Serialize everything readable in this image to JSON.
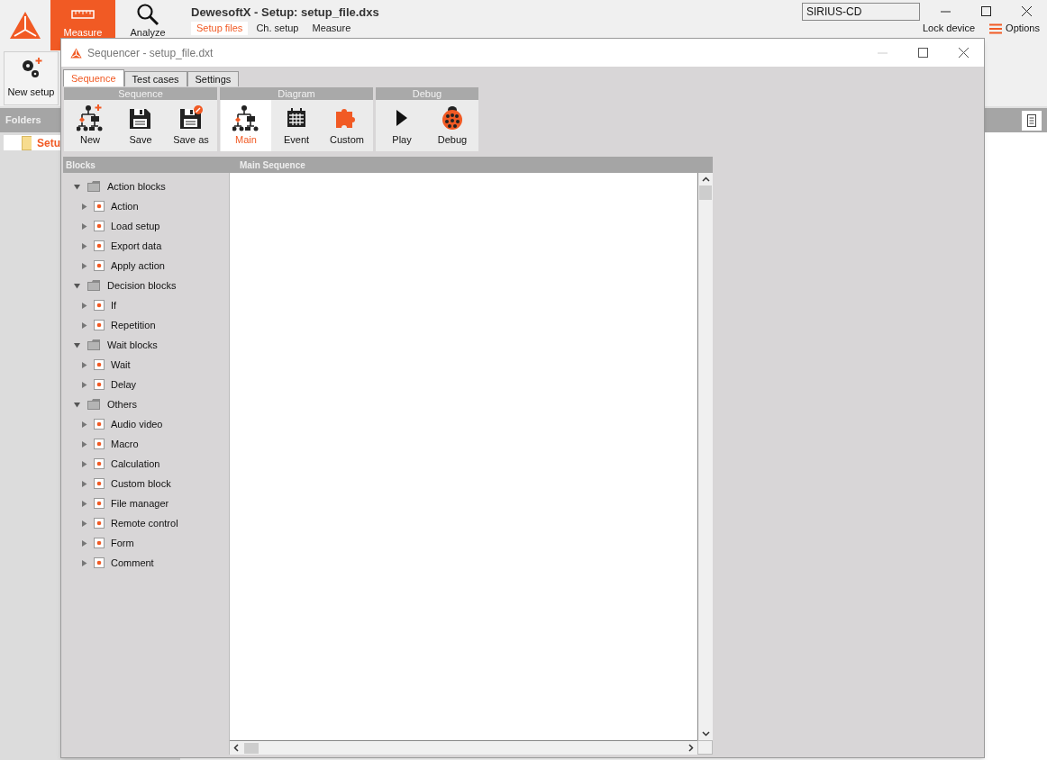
{
  "app": {
    "title": "DewesoftX - Setup: setup_file.dxs",
    "nav": [
      {
        "label": "Measure",
        "kind": "ruler",
        "selected": true
      },
      {
        "label": "Analyze",
        "kind": "magnifier",
        "selected": false
      }
    ],
    "tabs": [
      {
        "label": "Setup files",
        "selected": true
      },
      {
        "label": "Ch. setup",
        "selected": false
      },
      {
        "label": "Measure",
        "selected": false
      }
    ],
    "device_field": {
      "value": "SIRIUS-CD"
    },
    "lock_device": "Lock device",
    "options": "Options",
    "new_setup": "New setup",
    "folders": {
      "title": "Folders",
      "items": [
        "Setu"
      ]
    }
  },
  "dialog": {
    "title": "Sequencer - setup_file.dxt",
    "tabs": [
      {
        "label": "Sequence",
        "selected": true
      },
      {
        "label": "Test cases",
        "selected": false
      },
      {
        "label": "Settings",
        "selected": false
      }
    ],
    "ribbon": [
      {
        "title": "Sequence",
        "buttons": [
          {
            "label": "New",
            "kind": "new",
            "selected": false
          },
          {
            "label": "Save",
            "kind": "save",
            "selected": false
          },
          {
            "label": "Save as",
            "kind": "save_as",
            "selected": false
          }
        ]
      },
      {
        "title": "Diagram",
        "buttons": [
          {
            "label": "Main",
            "kind": "flow",
            "selected": true
          },
          {
            "label": "Event",
            "kind": "calendar",
            "selected": false
          },
          {
            "label": "Custom",
            "kind": "puzzle",
            "selected": false
          }
        ]
      },
      {
        "title": "Debug",
        "buttons": [
          {
            "label": "Play",
            "kind": "play",
            "selected": false
          },
          {
            "label": "Debug",
            "kind": "bug",
            "selected": false
          }
        ]
      }
    ],
    "blocks": {
      "title": "Blocks",
      "items": [
        {
          "label": "Action blocks",
          "expanded": true,
          "children": [
            {
              "label": "Action",
              "expanded": false
            },
            {
              "label": "Load setup",
              "expanded": false
            },
            {
              "label": "Export data",
              "expanded": false
            },
            {
              "label": "Apply action",
              "expanded": false
            }
          ]
        },
        {
          "label": "Decision blocks",
          "expanded": true,
          "children": [
            {
              "label": "If",
              "expanded": false
            },
            {
              "label": "Repetition",
              "expanded": false
            }
          ]
        },
        {
          "label": "Wait blocks",
          "expanded": true,
          "children": [
            {
              "label": "Wait",
              "expanded": false
            },
            {
              "label": "Delay",
              "expanded": false
            }
          ]
        },
        {
          "label": "Others",
          "expanded": true,
          "children": [
            {
              "label": "Audio video",
              "expanded": false
            },
            {
              "label": "Macro",
              "expanded": false
            },
            {
              "label": "Calculation",
              "expanded": false
            },
            {
              "label": "Custom block",
              "expanded": false
            },
            {
              "label": "File manager",
              "expanded": false
            },
            {
              "label": "Remote control",
              "expanded": false
            },
            {
              "label": "Form",
              "expanded": false
            },
            {
              "label": "Comment",
              "expanded": false
            }
          ]
        }
      ]
    },
    "canvas": {
      "title": "Main Sequence"
    }
  }
}
